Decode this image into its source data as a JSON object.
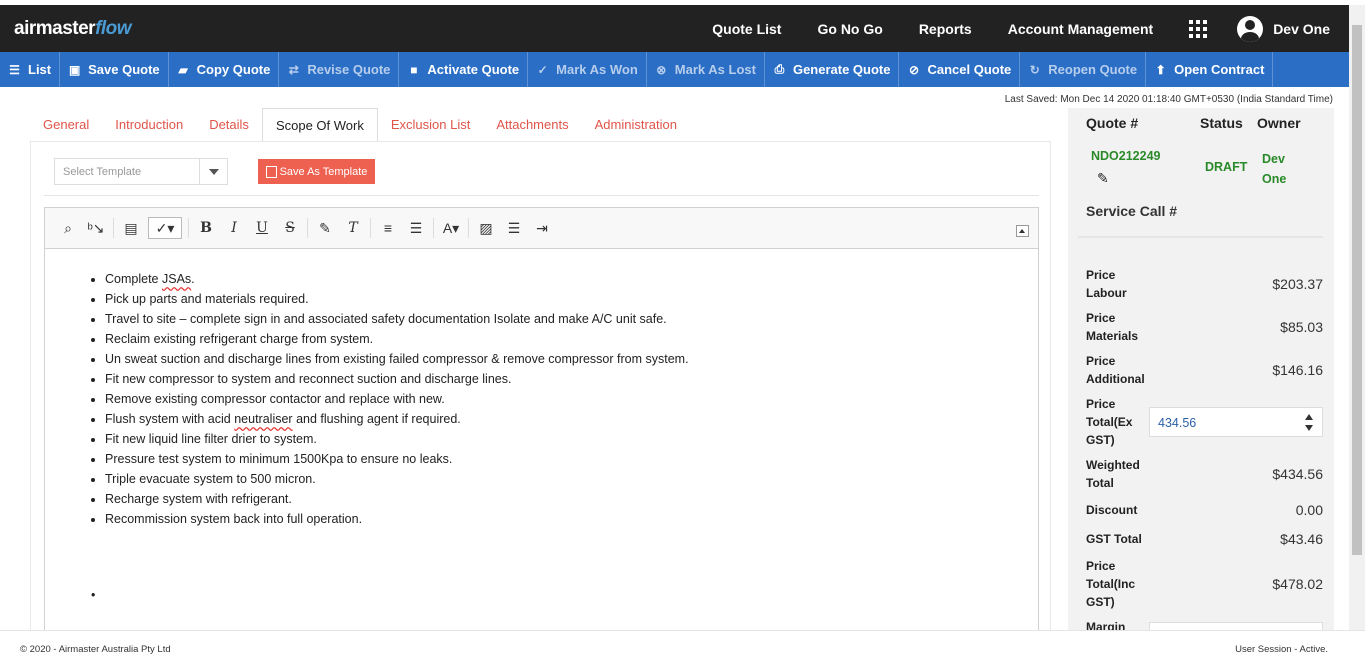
{
  "brand": {
    "part1": "airmaster",
    "part2": "flow"
  },
  "nav": {
    "links": [
      "Quote List",
      "Go No Go",
      "Reports",
      "Account Management"
    ],
    "user": "Dev One"
  },
  "toolbar": {
    "list": "List",
    "save_quote": "Save Quote",
    "copy_quote": "Copy Quote",
    "revise_quote": "Revise Quote",
    "activate_quote": "Activate Quote",
    "mark_won": "Mark As Won",
    "mark_lost": "Mark As Lost",
    "generate_quote": "Generate Quote",
    "cancel_quote": "Cancel Quote",
    "reopen_quote": "Reopen Quote",
    "open_contract": "Open Contract"
  },
  "last_saved": "Last Saved: Mon Dec 14 2020 01:18:40 GMT+0530 (India Standard Time)",
  "tabs": [
    "General",
    "Introduction",
    "Details",
    "Scope Of Work",
    "Exclusion List",
    "Attachments",
    "Administration"
  ],
  "active_tab": "Scope Of Work",
  "template": {
    "placeholder": "Select Template",
    "save_button": "Save As Template"
  },
  "scope_items": [
    "Complete JSAs.",
    "Pick up parts and materials required.",
    "Travel to site – complete sign in and associated safety documentation Isolate and make A/C unit safe.",
    "Reclaim existing refrigerant charge from system.",
    "Un sweat suction and discharge lines from existing failed compressor & remove compressor from system.",
    "Fit new compressor to system and reconnect suction and discharge lines.",
    "Remove existing compressor contactor and replace with new.",
    "Flush system with acid neutraliser and flushing agent if required.",
    "Fit new liquid line filter drier to system.",
    "Pressure test system to minimum 1500Kpa to ensure no leaks.",
    "Triple evacuate system to 500 micron.",
    "Recharge system with refrigerant.",
    "Recommission system back into full operation."
  ],
  "side": {
    "quote_label": "Quote #",
    "status_label": "Status",
    "owner_label": "Owner",
    "quote_number": "NDO212249",
    "status": "DRAFT",
    "owner": "Dev One",
    "service_call_label": "Service Call #",
    "price_labour_label": "Price Labour",
    "price_labour": "$203.37",
    "price_materials_label": "Price Materials",
    "price_materials": "$85.03",
    "price_additional_label": "Price Additional",
    "price_additional": "$146.16",
    "price_total_ex_label": "Price Total(Ex GST)",
    "price_total_ex": "434.56",
    "weighted_total_label": "Weighted Total",
    "weighted_total": "$434.56",
    "discount_label": "Discount",
    "discount": "0.00",
    "gst_total_label": "GST Total",
    "gst_total": "$43.46",
    "price_total_inc_label": "Price Total(Inc GST)",
    "price_total_inc": "$478.02",
    "margin_label": "Margin"
  },
  "footer": {
    "copyright": "© 2020 - Airmaster Australia Pty Ltd",
    "session": "User Session - Active."
  }
}
